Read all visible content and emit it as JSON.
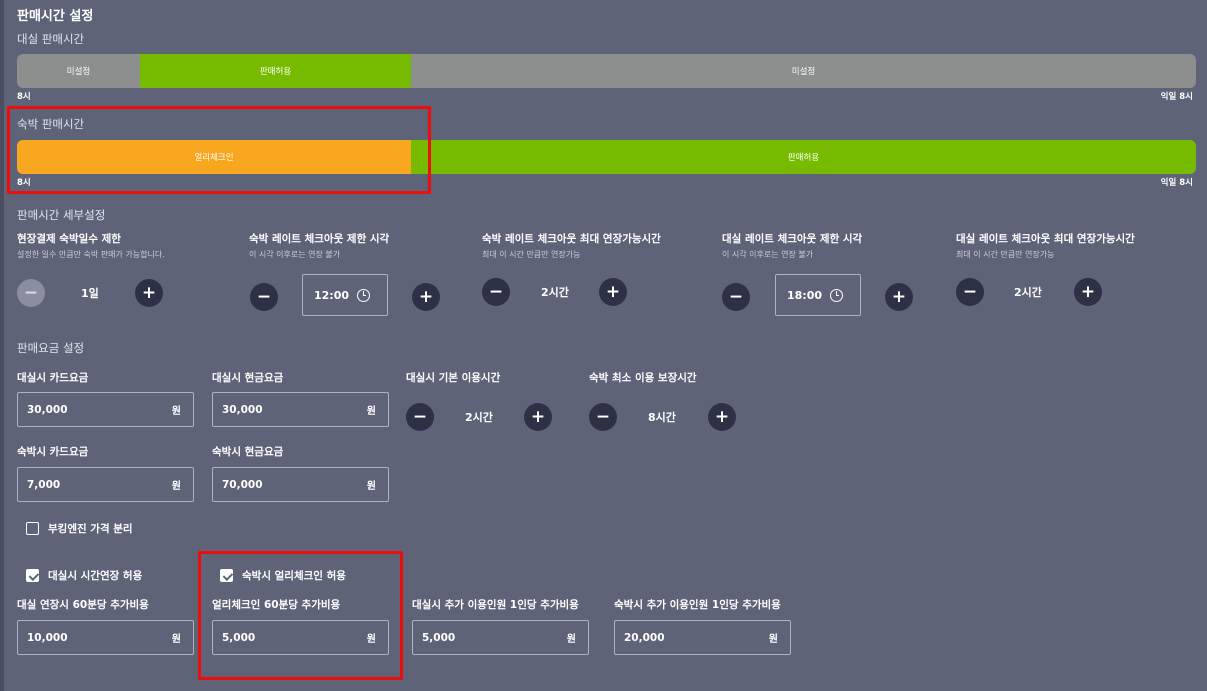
{
  "title": "판매시간 설정",
  "rental_time": {
    "heading": "대실 판매시간",
    "segments": [
      {
        "label": "미설정",
        "status": "unset",
        "share": 0.105
      },
      {
        "label": "판매허용",
        "status": "allowed",
        "share": 0.23
      },
      {
        "label": "미설정",
        "status": "unset",
        "share": 0.665
      }
    ],
    "start_label": "8시",
    "end_label": "익일 8시"
  },
  "stay_time": {
    "heading": "숙박 판매시간",
    "segments": [
      {
        "label": "얼리체크인",
        "status": "early",
        "share": 0.335
      },
      {
        "label": "판매허용",
        "status": "allowed",
        "share": 0.665
      }
    ],
    "start_label": "8시",
    "end_label": "익일 8시"
  },
  "detail": {
    "heading": "판매시간 세부설정",
    "items": [
      {
        "label": "현장결제 숙박일수 제한",
        "desc": "설정한 일수 만큼만 숙박 판매가 가능합니다.",
        "value": "1일"
      },
      {
        "label": "숙박 레이트 체크아웃 제한 시각",
        "desc": "이 시각 이후로는 연장 불가",
        "value": "12:00"
      },
      {
        "label": "숙박 레이트 체크아웃 최대 연장가능시간",
        "desc": "최대 이 시간 만큼만 연장가능",
        "value": "2시간"
      },
      {
        "label": "대실 레이트 체크아웃 제한 시각",
        "desc": "이 시각 이후로는 연장 불가",
        "value": "18:00"
      },
      {
        "label": "대실 레이트 체크아웃 최대 연장가능시간",
        "desc": "최대 이 시간 만큼만 연장가능",
        "value": "2시간"
      }
    ]
  },
  "pricing": {
    "heading": "판매요금 설정",
    "currency": "원",
    "rental_card": {
      "label": "대실시 카드요금",
      "value": "30,000"
    },
    "rental_cash": {
      "label": "대실시 현금요금",
      "value": "30,000"
    },
    "rental_base": {
      "label": "대실시 기본 이용시간",
      "value": "2시간"
    },
    "stay_min": {
      "label": "숙박 최소 이용 보장시간",
      "value": "8시간"
    },
    "stay_card": {
      "label": "숙박시 카드요금",
      "value": "7,000"
    },
    "stay_cash": {
      "label": "숙박시 현금요금",
      "value": "70,000"
    },
    "booking_split": {
      "label": "부킹엔진 가격 분리",
      "checked": false
    },
    "rental_extend": {
      "label": "대실시 시간연장 허용",
      "checked": true
    },
    "early_checkin": {
      "label": "숙박시 얼리체크인 허용",
      "checked": true
    },
    "rental_extend_fee": {
      "label": "대실 연장시 60분당 추가비용",
      "value": "10,000"
    },
    "early_fee": {
      "label": "얼리체크인 60분당 추가비용",
      "value": "5,000"
    },
    "rental_extra_person": {
      "label": "대실시 추가 이용인원 1인당 추가비용",
      "value": "5,000"
    },
    "stay_extra_person": {
      "label": "숙박시 추가 이용인원 1인당 추가비용",
      "value": "20,000"
    }
  },
  "icons": {
    "minus": "minus-icon",
    "plus": "plus-icon",
    "clock": "clock-icon",
    "checkbox": "checkbox-icon"
  },
  "colors": {
    "background": "#5f6378",
    "allowed": "#76bb00",
    "unset": "#8d8e8e",
    "early": "#f9a71f",
    "highlight": "#ee0d0d",
    "button": "#2e3145"
  }
}
